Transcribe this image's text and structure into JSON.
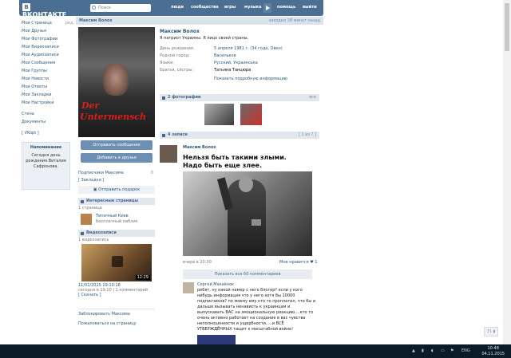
{
  "header": {
    "logo_text": "ВКОНТАКТЕ",
    "logo_letter": "В",
    "search_placeholder": "Поиск",
    "nav": [
      "люди",
      "сообщества",
      "игры",
      "музыка",
      "помощь",
      "выйти"
    ]
  },
  "left_menu": {
    "items": [
      "Мои Страница",
      "Мои Друзья",
      "Мои Фотографии",
      "Мои Видеозаписи",
      "Мои Аудиозаписи",
      "Мои Сообщения",
      "Мои Группы",
      "Мои Новости",
      "Мои Ответы",
      "Мои Закладки",
      "Мои Настройки"
    ],
    "edit_label": "ред.",
    "extra": [
      "Стена",
      "Документы"
    ],
    "vkopt": "[ VKopt ]",
    "reminder_title": "Напоминание",
    "reminder_text": "Сегодня день рождения Виталия Сафронова."
  },
  "profile_header": {
    "name": "Максим Волох",
    "status_time": "заходил 38 минут назад"
  },
  "profile_photo": {
    "caption_1": "Der",
    "caption_2": "Untermensch"
  },
  "actions": {
    "send_message": "Отправить сообщение",
    "add_friend": "Добавить в друзья",
    "subscribers": "Подписчики Максима",
    "subscribers_count": "8",
    "bookmarks": "[ Закладки ]",
    "send_gift": "Отправить подарок"
  },
  "interesting": {
    "title": "Интересные страницы",
    "count": "1 страница",
    "page_name": "Типичный Киев",
    "page_desc": "Бесплатный паблик"
  },
  "videos": {
    "title": "Видеозаписи",
    "count": "1 видеозапись",
    "duration": "12:29",
    "date": "11/01/2015 19:10:18",
    "meta": "сегодня в 19:10 | 1 комментарий",
    "download": "[ Скачать ]"
  },
  "left_footer": [
    "Заблокировать Максима",
    "Пожаловаться на страницу"
  ],
  "info": {
    "name": "Максим Волох",
    "status": "Я патриот Украины. Я лицо своей страны.",
    "rows": [
      {
        "k": "День рождения:",
        "v": "5 апреля 1981 г. (34 года, Овен)"
      },
      {
        "k": "Родной город:",
        "v": "Васильков"
      },
      {
        "k": "Языки:",
        "v": "Русский, Украинська"
      },
      {
        "k": "Братья, сёстры:",
        "v": "Татьяна Танцюра"
      }
    ],
    "more": "Показать подробную информацию"
  },
  "photos": {
    "title": "2 фотографии",
    "action": "все"
  },
  "wall": {
    "title": "4 записи",
    "pager": "[ 1 из ? ]",
    "author": "Максим Волох",
    "text_line1": "Нельзя быть такими злыми.",
    "text_line2": "Надо быть еще злее.",
    "date": "вчера в 20:30",
    "likes_label": "Мне нравится",
    "likes": "1",
    "show_comments": "Показать все 60 комментариев",
    "comment_author": "Сергей Макаёнок",
    "comment_text": "ребят, ну какой намер с него блогер? если у кого нибудь информация что у него хотя бы 10000 подписчиков? по моему ему кто то проплатил, что бы и дальше вызывать ненависть к украинцам и выпускавать ВАС на эмоциональную реакцию....кто то очень активно работает на создание в вас чувства неполноценности и ущербности.....и ВСЁ УТВЕРЖДЁННЫХ тащит к масштабной войне!"
  },
  "taskbar": {
    "lang": "ENG",
    "time": "10:48",
    "date": "04.11.2015"
  },
  "colors": {
    "header": "#4a6f93",
    "link": "#2b587a",
    "button": "#6d8fb3",
    "taskbar": "#0b1b27"
  }
}
